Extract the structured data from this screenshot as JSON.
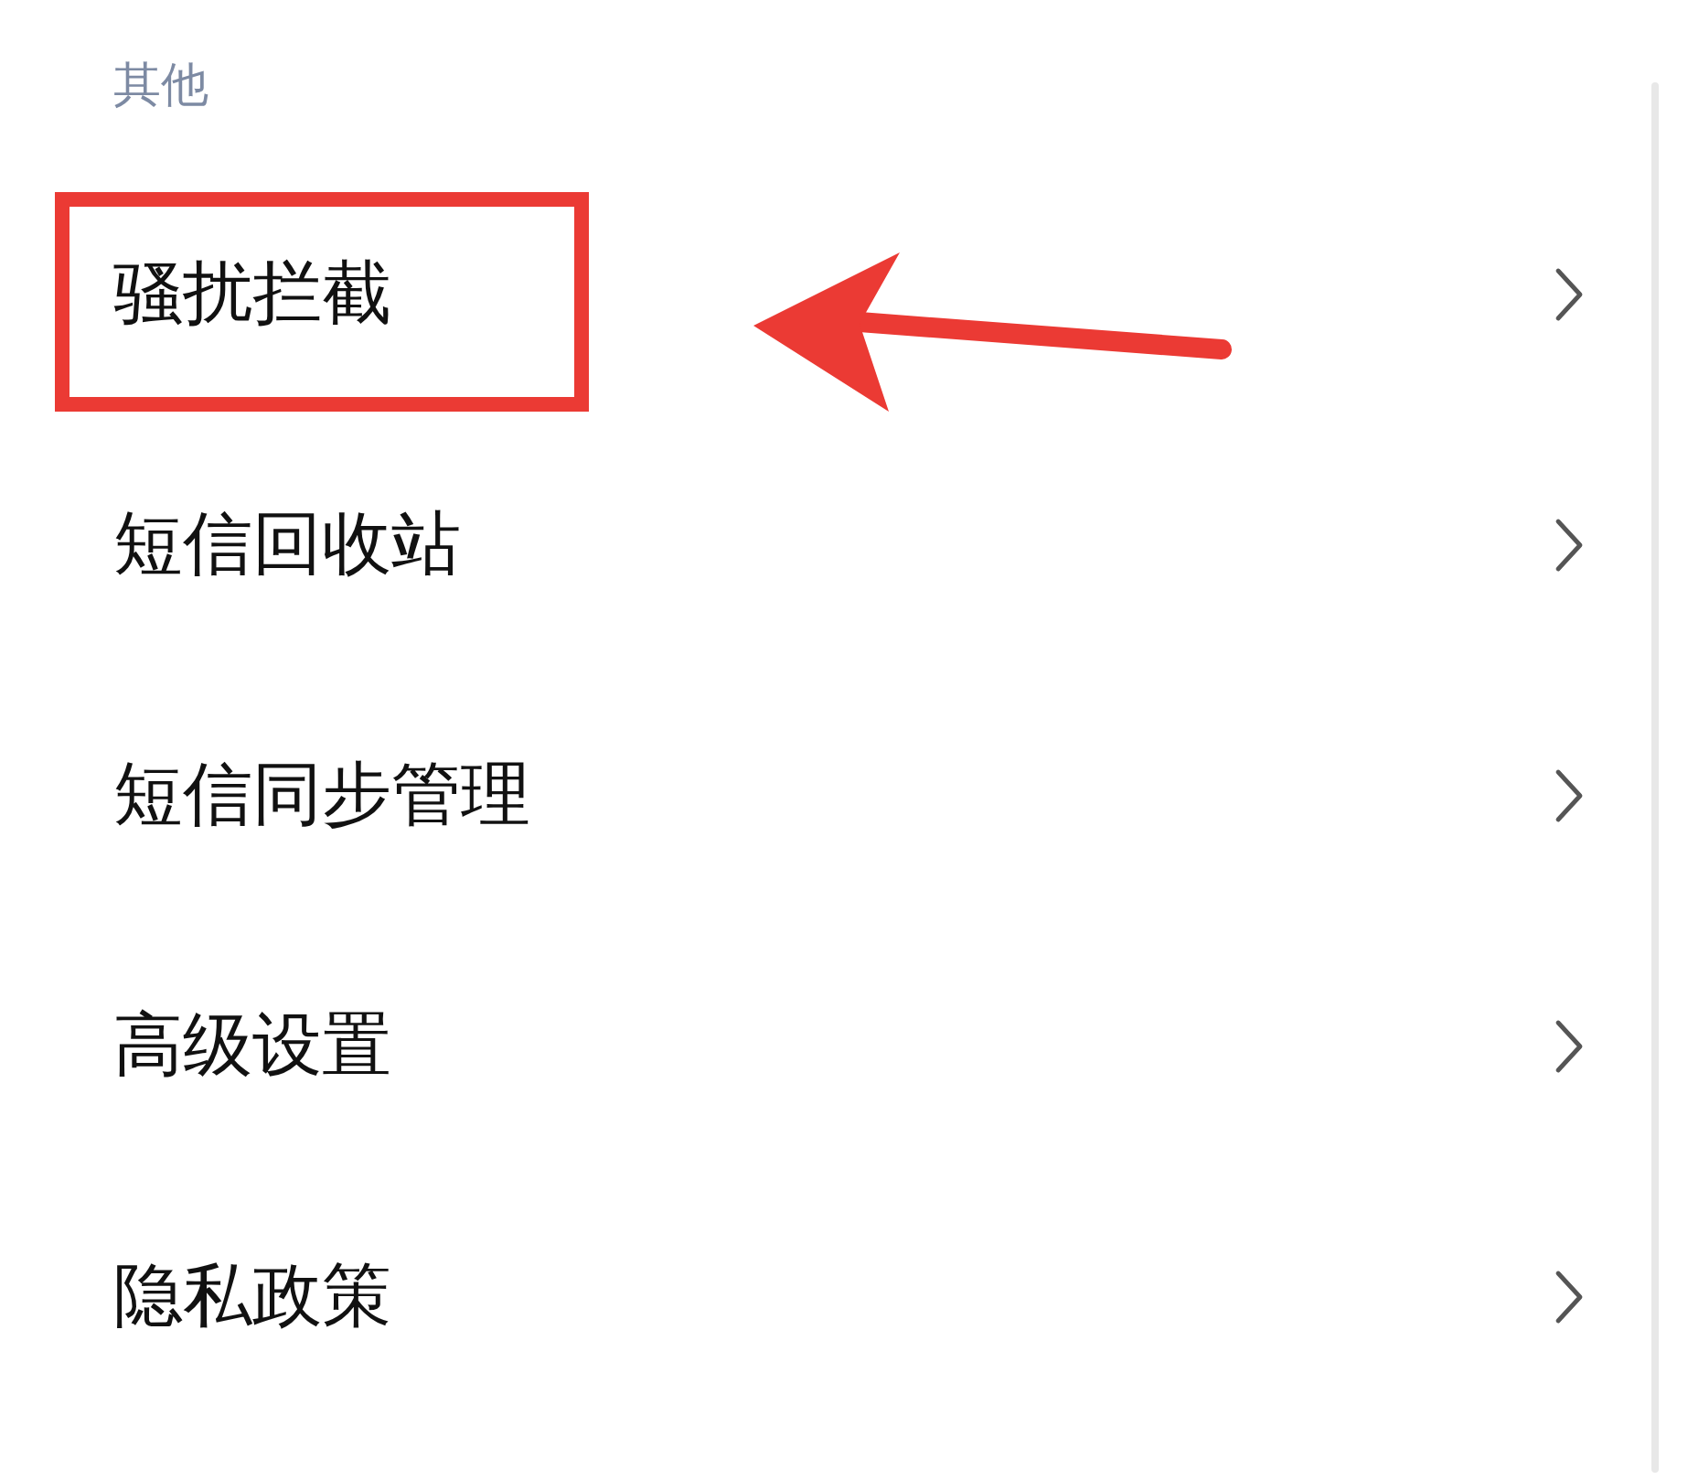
{
  "section": {
    "title": "其他"
  },
  "items": [
    {
      "label": "骚扰拦截",
      "highlighted": true,
      "arrow": true
    },
    {
      "label": "短信回收站",
      "highlighted": false
    },
    {
      "label": "短信同步管理",
      "highlighted": false
    },
    {
      "label": "高级设置",
      "highlighted": false
    },
    {
      "label": "隐私政策",
      "highlighted": false
    }
  ]
}
